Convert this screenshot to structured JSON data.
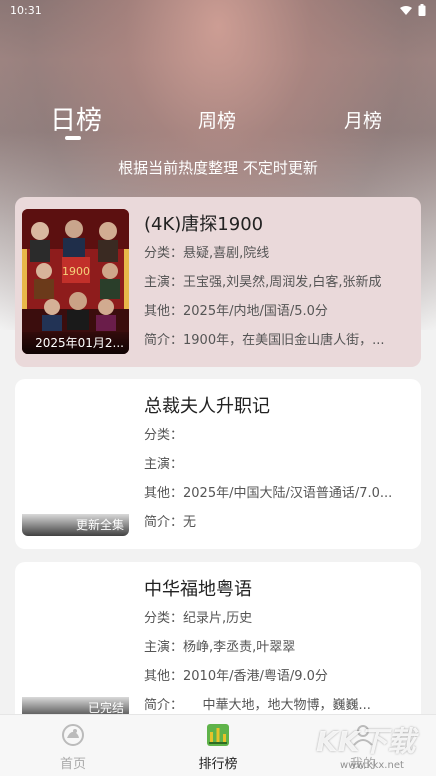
{
  "status_bar": {
    "time": "10:31"
  },
  "tabs": [
    {
      "label": "日榜",
      "active": true
    },
    {
      "label": "周榜",
      "active": false
    },
    {
      "label": "月榜",
      "active": false
    }
  ],
  "subtitle": "根据当前热度整理 不定时更新",
  "items": [
    {
      "title": "(4K)唐探1900",
      "poster_caption": "2025年01月2...",
      "category": "分类：悬疑,喜剧,院线",
      "cast": "主演：王宝强,刘昊然,周润发,白客,张新成",
      "other": "其他：2025年/内地/国语/5.0分",
      "intro": "简介：1900年，在美国旧金山唐人街，...",
      "highlighted": true
    },
    {
      "title": "总裁夫人升职记",
      "poster_caption": "更新全集",
      "category": "分类：",
      "cast": "主演：",
      "other": "其他：2025年/中国大陆/汉语普通话/7.0...",
      "intro": "简介：无",
      "highlighted": false
    },
    {
      "title": "中华福地粤语",
      "poster_caption": "已完结",
      "category": "分类：纪录片,历史",
      "cast": "主演：杨峥,李丞责,叶翠翠",
      "other": "其他：2010年/香港/粤语/9.0分",
      "intro": "简介：　　中華大地，地大物博，巍巍...",
      "highlighted": false
    }
  ],
  "bottom_nav": [
    {
      "label": "首页",
      "icon": "home-icon",
      "active": false
    },
    {
      "label": "排行榜",
      "icon": "ranking-icon",
      "active": true
    },
    {
      "label": "我的",
      "icon": "profile-icon",
      "active": false
    }
  ],
  "watermark": {
    "brand": "KK下载",
    "url": "www.kkx.net"
  },
  "colors": {
    "highlight_card": "#ead9da",
    "rank_icon_green": "#5fb34a",
    "rank_icon_yellow": "#e8c22a"
  }
}
